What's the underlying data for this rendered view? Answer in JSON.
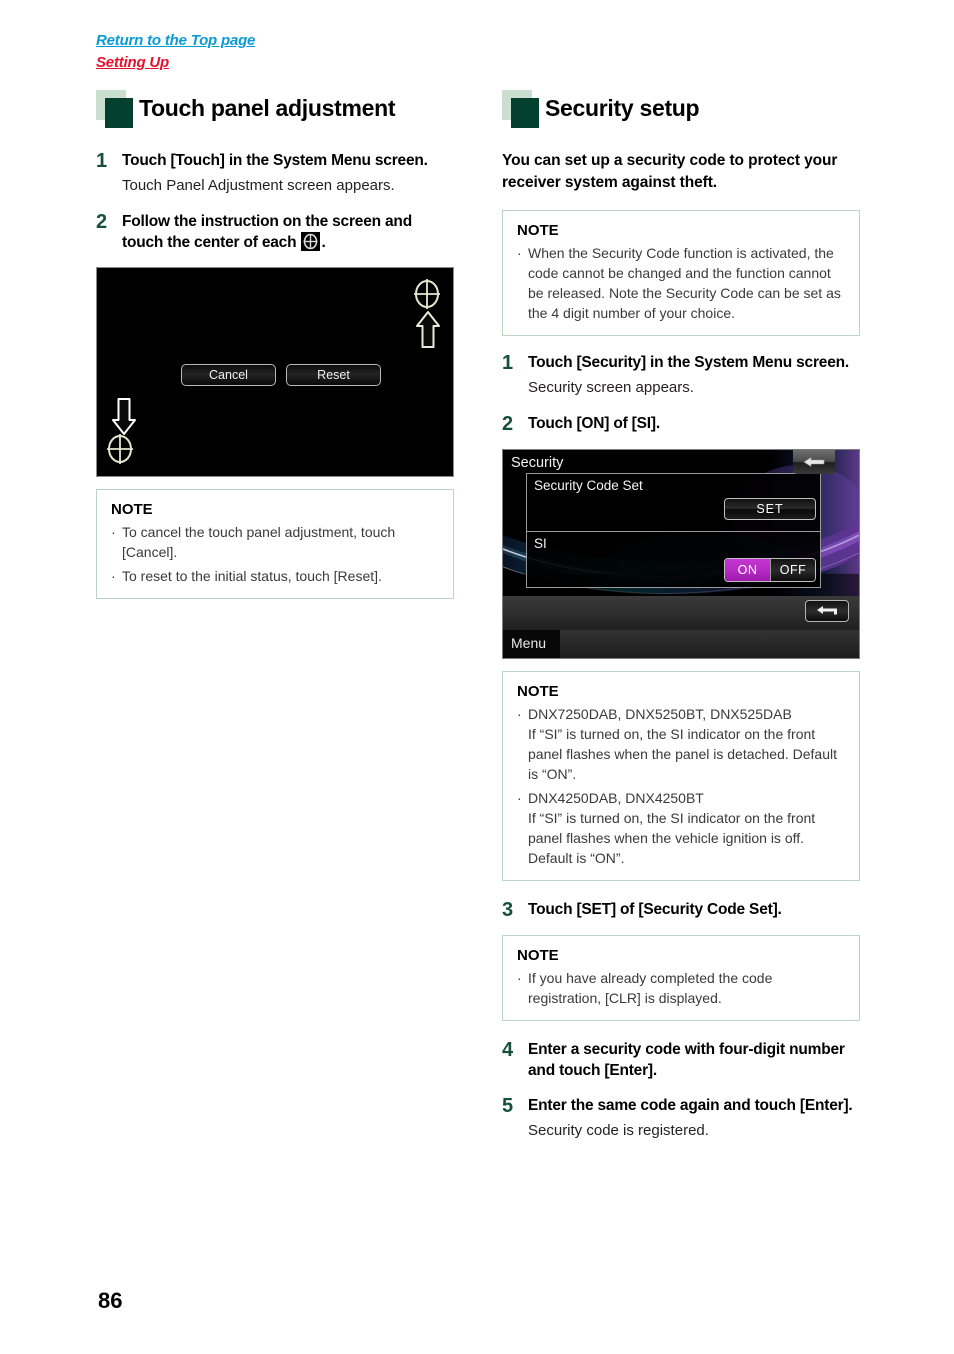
{
  "breadcrumb": {
    "top_link": "Return to the Top page",
    "sub_link": "Setting Up",
    "top_link_color": "#0a9bd4",
    "sub_link_color": "#e8112d"
  },
  "page_number": "86",
  "theme": {
    "marker_dark": "#04402e",
    "marker_light": "#cbdfd0",
    "step_number_color": "#14503c",
    "note_border": "#bcd4c2",
    "toggle_on_color": "#b62bc4"
  },
  "left_column": {
    "heading": "Touch panel adjustment",
    "steps": [
      {
        "num": "1",
        "title": "Touch [Touch] in the System Menu screen.",
        "desc": "Touch Panel Adjustment screen appears."
      },
      {
        "num": "2",
        "title_part1": "Follow the instruction on the screen and touch the center of each",
        "title_part2": "."
      }
    ],
    "screenshot": {
      "name": "touch-panel-adjustment-screen",
      "cancel_label": "Cancel",
      "reset_label": "Reset"
    },
    "note": {
      "title": "NOTE",
      "bullet": "·",
      "items": [
        "To cancel the touch panel adjustment, touch [Cancel].",
        "To reset to the initial status, touch [Reset]."
      ]
    }
  },
  "right_column": {
    "heading": "Security setup",
    "intro": "You can set up a security code to protect your receiver system against theft.",
    "note_top": {
      "title": "NOTE",
      "bullet": "·",
      "items": [
        "When the Security Code function is activated, the code cannot be changed and the function cannot be released. Note the Security Code can be set as the 4 digit number of your choice."
      ]
    },
    "steps_1_2": [
      {
        "num": "1",
        "title": "Touch [Security] in the System Menu screen.",
        "desc": "Security screen appears."
      },
      {
        "num": "2",
        "title": "Touch [ON] of [SI].",
        "desc": ""
      }
    ],
    "screenshot": {
      "name": "security-screen",
      "title": "Security",
      "row1_label": "Security Code Set",
      "set_label": "SET",
      "row2_label": "SI",
      "on_label": "ON",
      "off_label": "OFF",
      "menu_label": "Menu"
    },
    "note_models": {
      "title": "NOTE",
      "bullet": "·",
      "items": [
        "DNX7250DAB, DNX5250BT, DNX525DAB\nIf “SI” is turned on, the SI indicator on the front panel flashes when the panel is detached. Default is “ON”.",
        "DNX4250DAB, DNX4250BT\nIf “SI” is turned on, the SI indicator on the front panel flashes when the vehicle ignition is off. Default is “ON”."
      ]
    },
    "step_3": {
      "num": "3",
      "title": "Touch [SET] of [Security Code Set]."
    },
    "note_clr": {
      "title": "NOTE",
      "bullet": "·",
      "items": [
        "If you have already completed the code registration, [CLR] is displayed."
      ]
    },
    "steps_4_5": [
      {
        "num": "4",
        "title": "Enter a security code with four-digit number and touch [Enter].",
        "desc": ""
      },
      {
        "num": "5",
        "title": "Enter the same code again and touch [Enter].",
        "desc": "Security code is registered."
      }
    ]
  }
}
